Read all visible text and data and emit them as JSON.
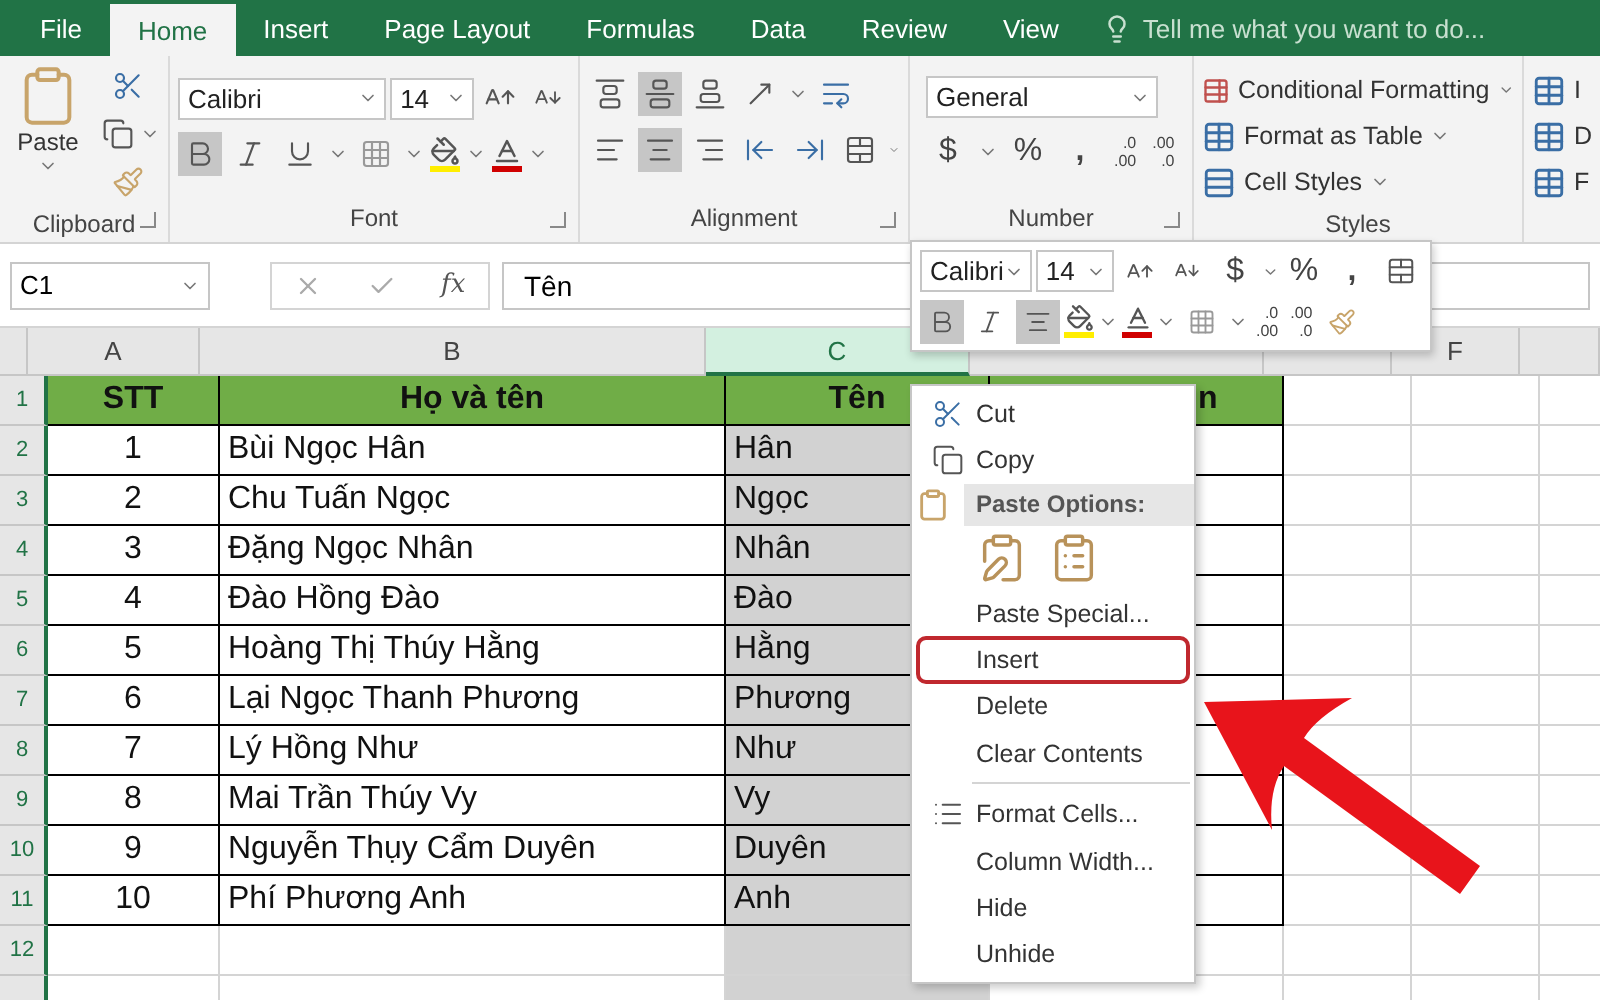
{
  "tabs": [
    {
      "label": "File",
      "selected": false
    },
    {
      "label": "Home",
      "selected": true
    },
    {
      "label": "Insert",
      "selected": false
    },
    {
      "label": "Page Layout",
      "selected": false
    },
    {
      "label": "Formulas",
      "selected": false
    },
    {
      "label": "Data",
      "selected": false
    },
    {
      "label": "Review",
      "selected": false
    },
    {
      "label": "View",
      "selected": false
    }
  ],
  "tell_me": {
    "placeholder": "Tell me what you want to do..."
  },
  "ribbon": {
    "clipboard": {
      "label": "Clipboard",
      "paste": "Paste"
    },
    "font": {
      "label": "Font",
      "name": "Calibri",
      "size": "14",
      "bold": {
        "selected": true
      },
      "italic": {
        "selected": false
      },
      "underline": {
        "selected": false
      }
    },
    "alignment": {
      "label": "Alignment",
      "vertical": [
        {
          "kind": "top",
          "selected": false
        },
        {
          "kind": "middle",
          "selected": true
        },
        {
          "kind": "bottom",
          "selected": false
        }
      ],
      "horizontal": [
        {
          "kind": "left",
          "selected": false
        },
        {
          "kind": "center",
          "selected": true
        },
        {
          "kind": "right",
          "selected": false
        }
      ]
    },
    "number": {
      "label": "Number",
      "format": "General",
      "currency": "$",
      "percent": "%",
      "comma": ",",
      "increase_decimal": [
        ".0",
        ".00"
      ],
      "decrease_decimal": [
        ".00",
        ".0"
      ]
    },
    "styles": {
      "label": "Styles",
      "items": [
        "Conditional Formatting",
        "Format as Table",
        "Cell Styles"
      ]
    },
    "cells": {
      "items": [
        "I",
        "D",
        "F"
      ]
    }
  },
  "formula_bar": {
    "name_box": "C1",
    "function_label": "fx",
    "value": "Tên"
  },
  "sheet": {
    "columns": [
      {
        "letter": "A",
        "selected": false
      },
      {
        "letter": "B",
        "selected": false
      },
      {
        "letter": "C",
        "selected": true
      },
      {
        "selected": false
      },
      {
        "selected": false
      },
      {
        "letter": "F",
        "selected": false
      }
    ],
    "rows": [
      {
        "number": "1",
        "kind": "header",
        "cells": [
          "STT",
          "Họ và tên",
          "Tên",
          "n"
        ]
      },
      {
        "number": "2",
        "kind": "data",
        "cells": [
          "1",
          "Bùi Ngọc Hân",
          "Hân"
        ]
      },
      {
        "number": "3",
        "kind": "data",
        "cells": [
          "2",
          "Chu Tuấn Ngọc",
          "Ngọc"
        ]
      },
      {
        "number": "4",
        "kind": "data",
        "cells": [
          "3",
          "Đặng Ngọc Nhân",
          "Nhân"
        ]
      },
      {
        "number": "5",
        "kind": "data",
        "cells": [
          "4",
          "Đào Hồng Đào",
          "Đào"
        ]
      },
      {
        "number": "6",
        "kind": "data",
        "cells": [
          "5",
          "Hoàng Thị Thúy Hằng",
          "Hằng"
        ]
      },
      {
        "number": "7",
        "kind": "data",
        "cells": [
          "6",
          "Lại Ngọc Thanh Phương",
          "Phương"
        ]
      },
      {
        "number": "8",
        "kind": "data",
        "cells": [
          "7",
          "Lý Hồng Như",
          "Như"
        ]
      },
      {
        "number": "9",
        "kind": "data",
        "cells": [
          "8",
          "Mai Trần Thúy Vy",
          "Vy"
        ]
      },
      {
        "number": "10",
        "kind": "data",
        "cells": [
          "9",
          "Nguyễn Thụy Cẩm Duyên",
          "Duyên"
        ]
      },
      {
        "number": "11",
        "kind": "data",
        "cells": [
          "10",
          "Phí Phương Anh",
          "Anh"
        ]
      },
      {
        "number": "12",
        "kind": "empty",
        "cells": []
      }
    ]
  },
  "mini_toolbar": {
    "font": "Calibri",
    "size": "14",
    "currency": "$",
    "percent": "%",
    "comma": ",",
    "bold": {
      "selected": true
    },
    "italic": {
      "selected": false
    },
    "center": {
      "selected": true
    },
    "increase_decimal": [
      ".0",
      ".00"
    ],
    "decrease_decimal": [
      ".00",
      ".0"
    ]
  },
  "context_menu": {
    "items": [
      {
        "kind": "item",
        "label": "Cut",
        "highlighted": false
      },
      {
        "kind": "item",
        "label": "Copy",
        "highlighted": false
      },
      {
        "kind": "header",
        "label": "Paste Options:"
      },
      {
        "kind": "paste_icons"
      },
      {
        "kind": "item",
        "label": "Paste Special...",
        "highlighted": false
      },
      {
        "kind": "item",
        "label": "Insert",
        "highlighted": true
      },
      {
        "kind": "item",
        "label": "Delete",
        "highlighted": false
      },
      {
        "kind": "item",
        "label": "Clear Contents",
        "highlighted": false
      },
      {
        "kind": "separator"
      },
      {
        "kind": "item",
        "label": "Format Cells...",
        "highlighted": false
      },
      {
        "kind": "item",
        "label": "Column Width...",
        "highlighted": false
      },
      {
        "kind": "item",
        "label": "Hide",
        "highlighted": false
      },
      {
        "kind": "item",
        "label": "Unhide",
        "highlighted": false
      }
    ]
  }
}
